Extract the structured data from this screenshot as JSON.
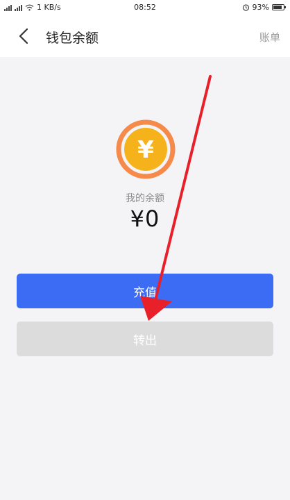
{
  "status_bar": {
    "speed": "1 KB/s",
    "time": "08:52",
    "battery": "93%"
  },
  "header": {
    "title": "钱包余额",
    "bill_label": "账单"
  },
  "wallet": {
    "coin_symbol": "¥",
    "balance_label": "我的余额",
    "balance_amount": "¥0"
  },
  "actions": {
    "recharge_label": "充值",
    "withdraw_label": "转出"
  },
  "colors": {
    "primary": "#3c6cf4",
    "coin_ring": "#f58a4a",
    "coin_yellow": "#f6b21b",
    "disabled": "#dcdcdc",
    "annotation": "#e8202a"
  }
}
